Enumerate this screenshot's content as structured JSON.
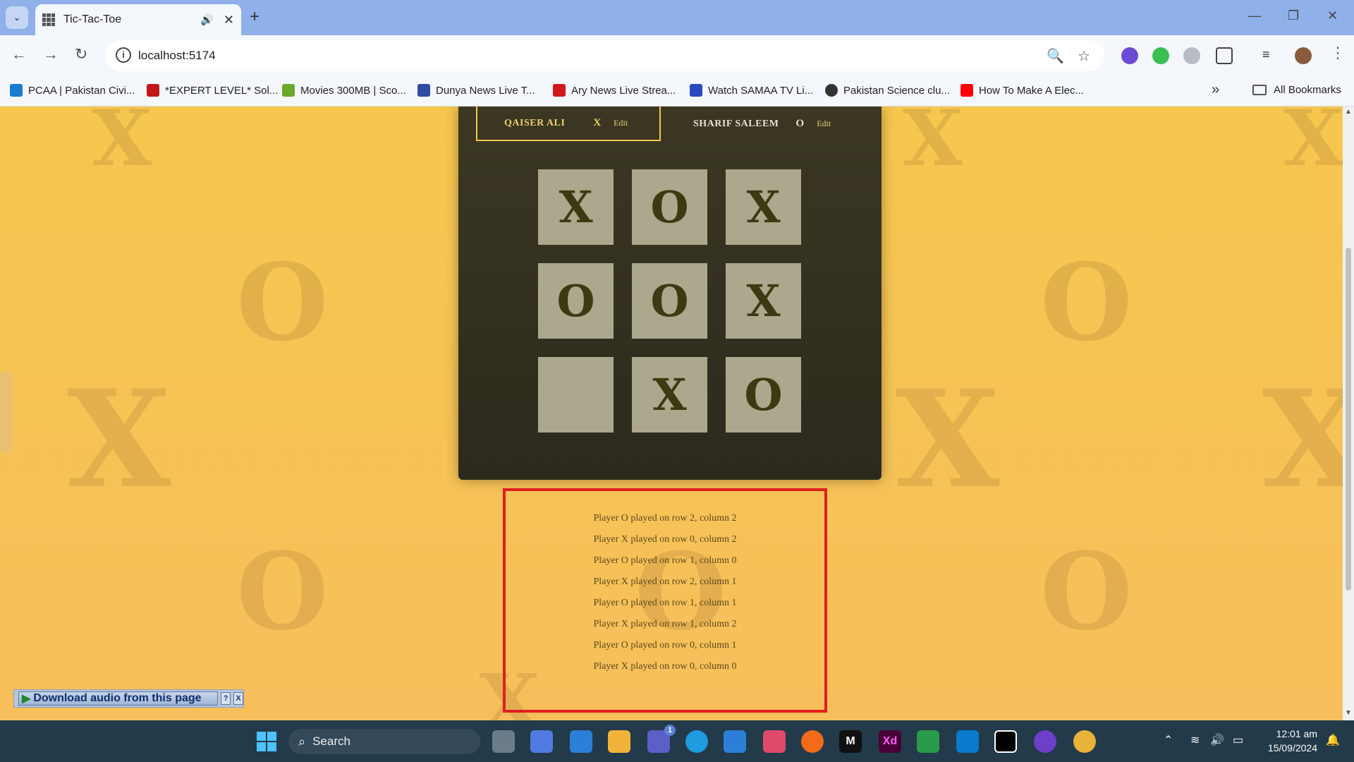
{
  "browser": {
    "tab_title": "Tic-Tac-Toe",
    "url": "localhost:5174",
    "bookmarks": [
      {
        "label": "PCAA | Pakistan Civi...",
        "color": "#1a7bd0"
      },
      {
        "label": "*EXPERT LEVEL* Sol...",
        "color": "#c01818"
      },
      {
        "label": "Movies 300MB | Sco...",
        "color": "#6aa92b"
      },
      {
        "label": "Dunya News Live T...",
        "color": "#2c4da0"
      },
      {
        "label": "Ary News Live Strea...",
        "color": "#d11818"
      },
      {
        "label": "Watch SAMAA TV Li...",
        "color": "#2a49c0"
      },
      {
        "label": "Pakistan Science clu...",
        "color": "#333333"
      },
      {
        "label": "How To Make A Elec...",
        "color": "#ff0000"
      }
    ],
    "all_bookmarks_label": "All Bookmarks"
  },
  "game": {
    "players": [
      {
        "name": "QAISER ALI",
        "symbol": "X",
        "edit_label": "Edit",
        "active": true
      },
      {
        "name": "SHARIF SALEEM",
        "symbol": "O",
        "edit_label": "Edit",
        "active": false
      }
    ],
    "board": [
      [
        "X",
        "O",
        "X"
      ],
      [
        "O",
        "O",
        "X"
      ],
      [
        "",
        "X",
        "O"
      ]
    ]
  },
  "log": [
    "Player O played on row 2, column 2",
    "Player X played on row 0, column 2",
    "Player O played on row 1, column 0",
    "Player X played on row 2, column 1",
    "Player O played on row 1, column 1",
    "Player X played on row 1, column 2",
    "Player O played on row 0, column 1",
    "Player X played on row 0, column 0"
  ],
  "download_bar": {
    "label": "Download audio from this page",
    "help": "?",
    "close": "X"
  },
  "taskbar": {
    "search_placeholder": "Search",
    "teams_badge": "1",
    "time": "12:01 am",
    "date": "15/09/2024"
  },
  "colors": {
    "accent_border": "#e01f1f",
    "board_bg": "#2f2d20",
    "cell_bg": "#aca88d",
    "page_bg": "#f6c453"
  }
}
